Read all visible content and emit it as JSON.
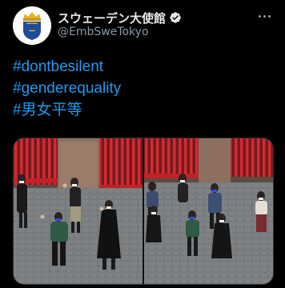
{
  "tweet": {
    "display_name": "スウェーデン大使館",
    "handle": "@EmbSweTokyo",
    "hashtags": [
      "#dontbesilent",
      "#genderequality",
      "#男女平等"
    ]
  },
  "icons": {
    "avatar": "swedish-crest-icon",
    "verified": "verified-badge-icon",
    "more": "more-options-icon"
  },
  "colors": {
    "background": "#000000",
    "link": "#1d9bf0",
    "verified": "#e7e9ea",
    "text_primary": "#e7e9ea",
    "text_secondary": "#8b98a5"
  }
}
